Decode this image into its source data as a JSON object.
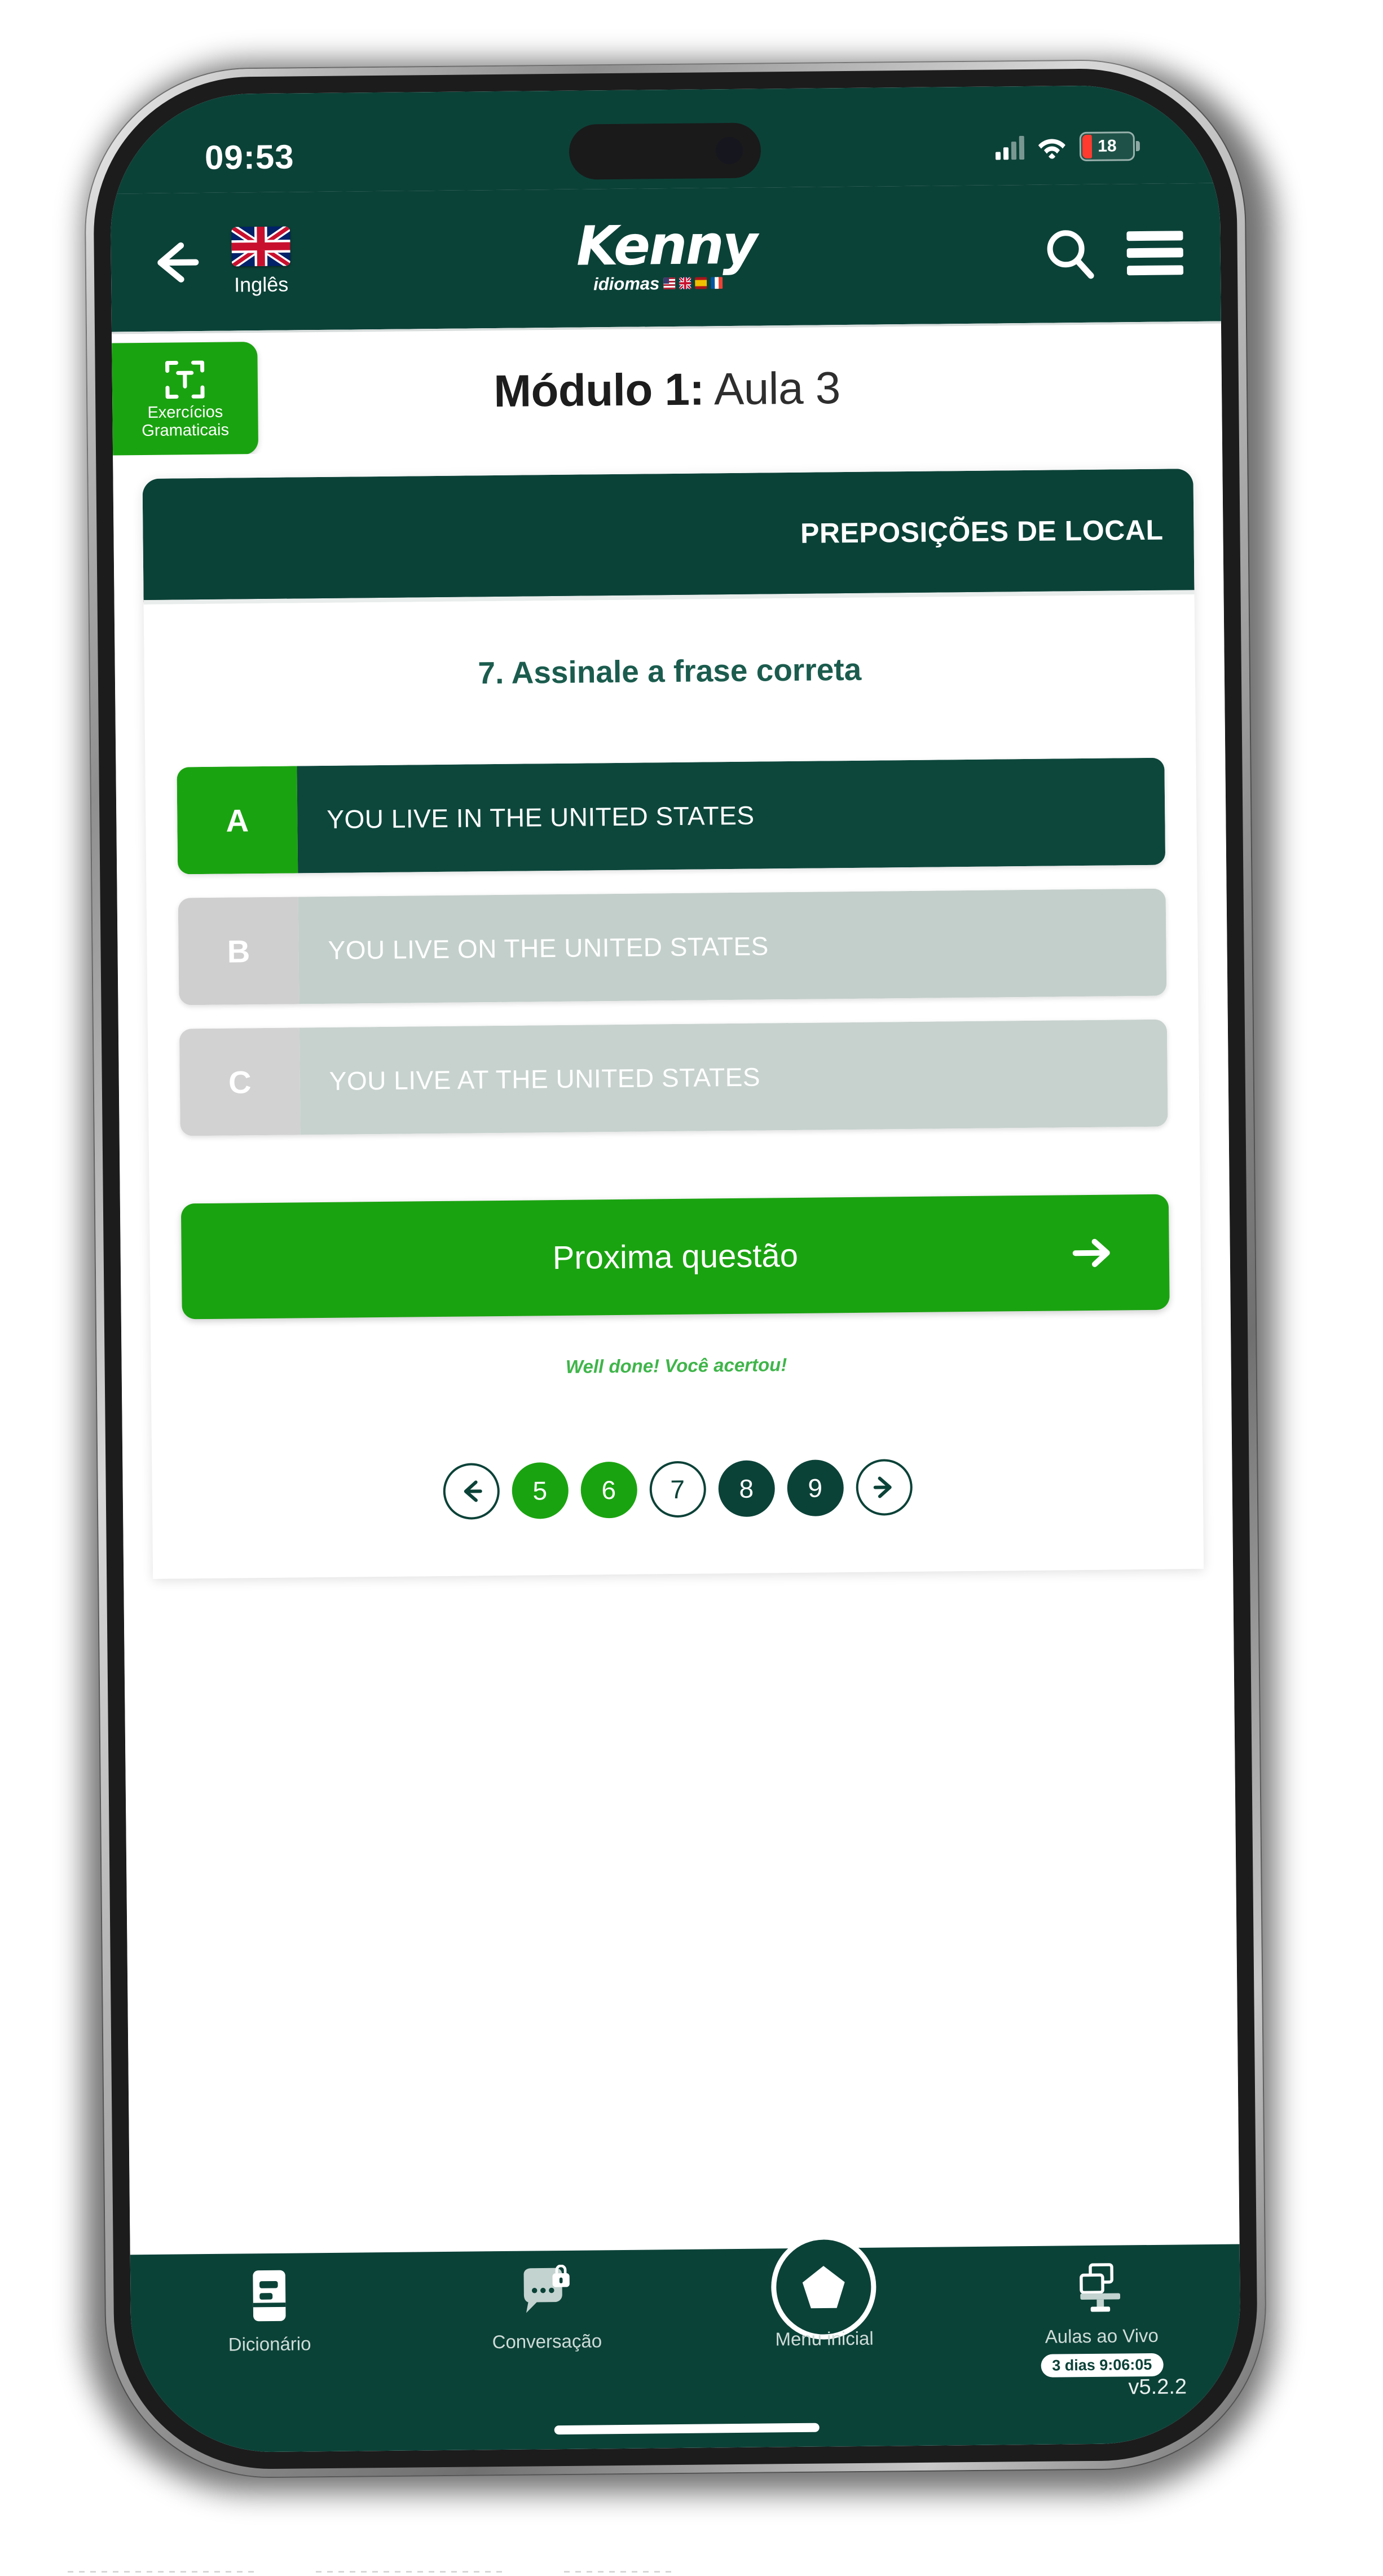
{
  "status_bar": {
    "time": "09:53",
    "battery_percent": "18",
    "battery_level": 18,
    "battery_color": "#ff3b30",
    "signal_icon": "cellular-signal-icon",
    "wifi_icon": "wifi-icon"
  },
  "header": {
    "back_icon": "back-arrow-icon",
    "language_label": "Inglês",
    "flag_icon": "uk-flag-icon",
    "logo_main": "Kenny",
    "logo_sub": "idiomas",
    "search_icon": "search-icon",
    "menu_icon": "hamburger-menu-icon"
  },
  "title_row": {
    "grammar_tab_icon": "text-selection-icon",
    "grammar_tab_line1": "Exercícios",
    "grammar_tab_line2": "Gramaticais",
    "module_label": "Módulo 1:",
    "lesson_label": "Aula 3"
  },
  "card": {
    "header_title": "PREPOSIÇÕES DE LOCAL",
    "question": "7. Assinale a frase correta",
    "options": [
      {
        "letter": "A",
        "text": "YOU LIVE IN THE UNITED STATES",
        "state": "selected"
      },
      {
        "letter": "B",
        "text": "YOU LIVE ON THE UNITED STATES",
        "state": "dim-a"
      },
      {
        "letter": "C",
        "text": "YOU LIVE AT THE UNITED STATES",
        "state": "dim-b"
      }
    ],
    "next_button": "Proxima questão",
    "next_arrow_icon": "arrow-right-icon",
    "feedback": "Well done! Você acertou!"
  },
  "pagination": {
    "prev_icon": "arrow-left-circle-icon",
    "next_icon": "arrow-right-circle-icon",
    "pages": [
      {
        "label": "5",
        "style": "pd-green"
      },
      {
        "label": "6",
        "style": "pd-green"
      },
      {
        "label": "7",
        "style": "pd-outline"
      },
      {
        "label": "8",
        "style": "pd-dark"
      },
      {
        "label": "9",
        "style": "pd-dark"
      }
    ]
  },
  "bottom_nav": {
    "items": [
      {
        "label": "Dicionário",
        "icon": "dictionary-book-icon"
      },
      {
        "label": "Conversação",
        "icon": "chat-bubble-lock-icon"
      },
      {
        "label": "Menu inicial",
        "icon": "home-pentagon-icon"
      },
      {
        "label": "Aulas ao Vivo",
        "icon": "live-classes-screen-icon",
        "badge": "3 dias 9:06:05"
      }
    ],
    "version": "v5.2.2"
  },
  "colors": {
    "brand_dark_green": "#0b4238",
    "brand_bright_green": "#1aa310",
    "card_dark": "#0d473c",
    "disabled_a": "#c3cfcb",
    "disabled_b": "#c7d2ce",
    "feedback_green": "#3fb54a",
    "battery_red": "#ff3b30"
  }
}
